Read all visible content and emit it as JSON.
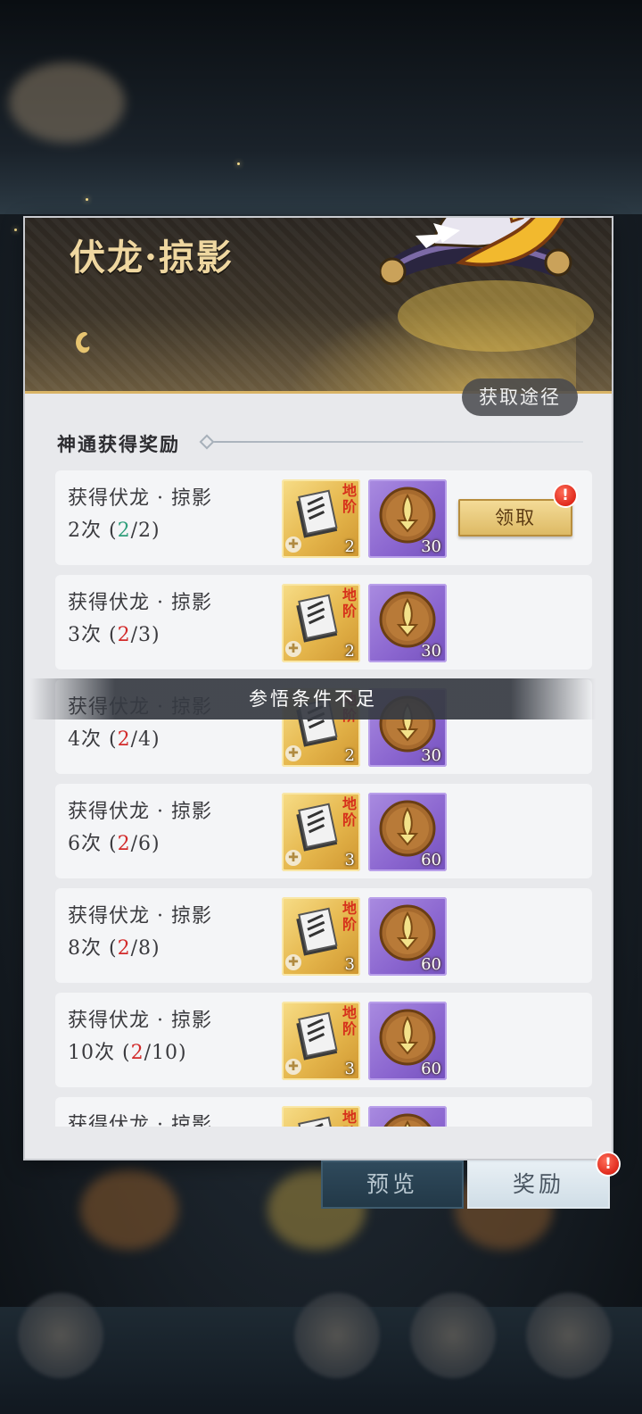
{
  "header": {
    "title": "伏龙·掠影",
    "acquire_label": "获取途径"
  },
  "section": {
    "title": "神通获得奖励"
  },
  "rewards": [
    {
      "line1": "获得伏龙 · 掠影",
      "count": "2次",
      "current": "2",
      "total": "2",
      "complete": true,
      "item1_grade": "地阶",
      "item1_qty": "2",
      "item2_qty": "30",
      "claim_label": "领取"
    },
    {
      "line1": "获得伏龙 · 掠影",
      "count": "3次",
      "current": "2",
      "total": "3",
      "complete": false,
      "item1_grade": "地阶",
      "item1_qty": "2",
      "item2_qty": "30"
    },
    {
      "line1": "获得伏龙 · 掠影",
      "count": "4次",
      "current": "2",
      "total": "4",
      "complete": false,
      "item1_grade": "地阶",
      "item1_qty": "2",
      "item2_qty": "30"
    },
    {
      "line1": "获得伏龙 · 掠影",
      "count": "6次",
      "current": "2",
      "total": "6",
      "complete": false,
      "item1_grade": "地阶",
      "item1_qty": "3",
      "item2_qty": "60"
    },
    {
      "line1": "获得伏龙 · 掠影",
      "count": "8次",
      "current": "2",
      "total": "8",
      "complete": false,
      "item1_grade": "地阶",
      "item1_qty": "3",
      "item2_qty": "60"
    },
    {
      "line1": "获得伏龙 · 掠影",
      "count": "10次",
      "current": "2",
      "total": "10",
      "complete": false,
      "item1_grade": "地阶",
      "item1_qty": "3",
      "item2_qty": "60"
    },
    {
      "line1": "获得伏龙 · 掠影",
      "count": "",
      "current": "",
      "total": "",
      "complete": false,
      "item1_grade": "地阶",
      "item1_qty": "",
      "item2_qty": ""
    }
  ],
  "toast": "参悟条件不足",
  "tabs": {
    "preview": "预览",
    "reward": "奖励"
  },
  "alert_mark": "!",
  "colors": {
    "progress_complete": "#2e9e7a",
    "progress_incomplete": "#d22a2a",
    "accent_gold": "#d9b466"
  }
}
